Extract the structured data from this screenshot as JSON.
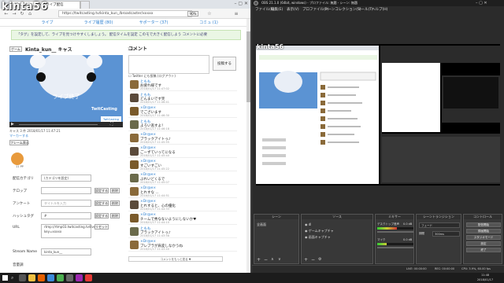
{
  "browser": {
    "tab1": "Kinta_kun_ さんのライブ配信",
    "tab2": "",
    "url": "https://twitcasting.tv/kinta_kun_/broadcaster/xxxxx",
    "zoom": "90%"
  },
  "watermark": "kinta56",
  "site_nav": [
    "ライブ",
    "ライブ履歴 (80)",
    "サポーター (37)",
    "コミュ (1)"
  ],
  "notice": "「タグ」を設定して、ライブを見つけやすくしましょう。  配信タイムを設定  このモで大きく配信しよう   コメントに必要",
  "channel": {
    "btn": "ゲーム",
    "name": "Kinta_kun__ キャス",
    "count": "1:32"
  },
  "player": {
    "status": "ライブ終了",
    "brand": "TwitCasting",
    "brand2": "TwitCasting"
  },
  "under_player": {
    "row1": "キャス 3 件   2018/01/17 11:47:21",
    "row2": "マーカーする",
    "row3": "フレーム表示"
  },
  "gift_count": "11 PP",
  "form": {
    "category_label": "配信カテゴリ",
    "category_value": "(カテゴリを設定)",
    "telop_label": "テロップ",
    "announce_label": "アンケート",
    "announce_placeholder": "タイトルを入力",
    "hashtag_label": "ハッシュタグ",
    "hashtag_value": "#",
    "url_label": "URL",
    "url_value": "rtmp://rtmp03.twitcasting.tv/live?key=xxxxx",
    "stream_label": "Stream Name",
    "stream_value": "kinta_kun__",
    "volume_label": "音量調",
    "set_btn": "設定する",
    "delete_btn": "削除",
    "reset_btn": "リセット"
  },
  "comment": {
    "header": "コメント",
    "post_btn": "投稿する",
    "twitter": "Twitter にも投稿 (ログアウト)",
    "items": [
      {
        "name": "ともも",
        "text": "お疲れ様です",
        "date": "2018/01/17 11:47:02"
      },
      {
        "name": "ともも",
        "text": "どんまいです笑",
        "date": "2018/01/17 11:46:41"
      },
      {
        "name": "×Dr@e×",
        "text": "でございます",
        "date": "2018/01/17 11:46:30"
      },
      {
        "name": "ともも",
        "text": "よろい逃すよ！",
        "date": "2018/01/17 11:46:18"
      },
      {
        "name": "×Dr@e×",
        "text": "ブラックアイトっ♪",
        "date": "2018/01/17 11:45:55"
      },
      {
        "name": "×Dr@e×",
        "text": "ごーずていってになる",
        "date": "2018/01/17 11:45:40"
      },
      {
        "name": "×Dr@e×",
        "text": "すごいすごい",
        "date": "2018/01/17 11:45:22"
      },
      {
        "name": "×Dr@e×",
        "text": "ぶれいどくるで",
        "date": "2018/01/17 11:45:07"
      },
      {
        "name": "×Dr@e×",
        "text": "とれすな ...",
        "date": "2018/01/17 11:44:51"
      },
      {
        "name": "×Dr@e×",
        "text": "とれすると、心の優化",
        "date": "2018/01/17 11:44:33"
      },
      {
        "name": "×Dr@e×",
        "text": "チームで秀なないようにしないか♥",
        "date": "2018/01/17 11:44:10"
      },
      {
        "name": "ともも",
        "text": "ブラックアイトっ♪",
        "date": "2018/01/17 11:43:58"
      },
      {
        "name": "×Dr@e×",
        "text": "ブレブラが肩変しなかうね",
        "date": "2018/01/17 11:43:40"
      }
    ],
    "more": "コメントをもっと見る ▼"
  },
  "obs": {
    "title": "OBS 21.1.0 (64bit, windows) - プロファイル: 無題 - シーン: 無題",
    "menu": [
      "ファイル(F)",
      "編集(E)",
      "表示(V)",
      "プロファイル(P)",
      "シーンコレクション(S)",
      "ツール(T)",
      "ヘルプ(H)"
    ],
    "scenes_header": "シーン",
    "scene1": "全画面",
    "sources_header": "ソース",
    "sources": [
      "dl",
      "ゲームキャプチャ",
      "画面キャプチャ"
    ],
    "mixer_header": "ミキサー",
    "mixer1": "デスクトップ音声",
    "mixer1_db": "0.0 dB",
    "mixer2": "マイク",
    "mixer2_db": "0.0 dB",
    "mixer1_level": 0.55,
    "mixer2_level": 0.25,
    "transitions_header": "シーントランジション",
    "transition": "フェード",
    "duration_label": "期間",
    "duration": "300ms",
    "controls_header": "コントロール",
    "controls": [
      "配信開始",
      "録画開始",
      "スタジオモード",
      "設定",
      "終了"
    ],
    "status": {
      "live": "LIVE: 00:00:00",
      "rec": "REC: 00:00:00",
      "cpu": "CPU: 3.9%, 60.00 fps"
    }
  },
  "taskbar": {
    "time": "11:48",
    "date": "2018/01/17"
  }
}
